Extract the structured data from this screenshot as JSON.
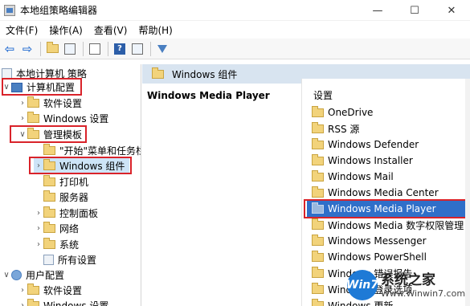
{
  "window": {
    "title": "本地组策略编辑器",
    "controls": {
      "minimize": "—",
      "maximize": "☐",
      "close": "✕"
    }
  },
  "menu": [
    "文件(F)",
    "操作(A)",
    "查看(V)",
    "帮助(H)"
  ],
  "tree": {
    "root": "本地计算机 策略",
    "computer_config": "计算机配置",
    "software_settings": "软件设置",
    "windows_settings": "Windows 设置",
    "admin_templates": "管理模板",
    "start_menu": "\"开始\"菜单和任务栏",
    "windows_components": "Windows 组件",
    "printers": "打印机",
    "servers": "服务器",
    "control_panel": "控制面板",
    "network": "网络",
    "system": "系统",
    "all_settings": "所有设置",
    "user_config": "用户配置",
    "user_software": "软件设置",
    "user_windows": "Windows 设置"
  },
  "right": {
    "header": "Windows 组件",
    "detail_title": "Windows Media Player",
    "list_header": "设置",
    "items": [
      "OneDrive",
      "RSS 源",
      "Windows Defender",
      "Windows Installer",
      "Windows Mail",
      "Windows Media Center",
      "Windows Media Player",
      "Windows Media 数字权限管理",
      "Windows Messenger",
      "Windows PowerShell",
      "Windows 错误报告",
      "Windows 登录选项",
      "Windows 更新"
    ]
  },
  "watermark": {
    "logo": "Win7",
    "name": "系统之家",
    "url": "Www.Winwin7.com"
  },
  "colors": {
    "highlight": "#2f6fc9",
    "annotation": "#d9232a",
    "header_bg": "#d8e4f0"
  }
}
